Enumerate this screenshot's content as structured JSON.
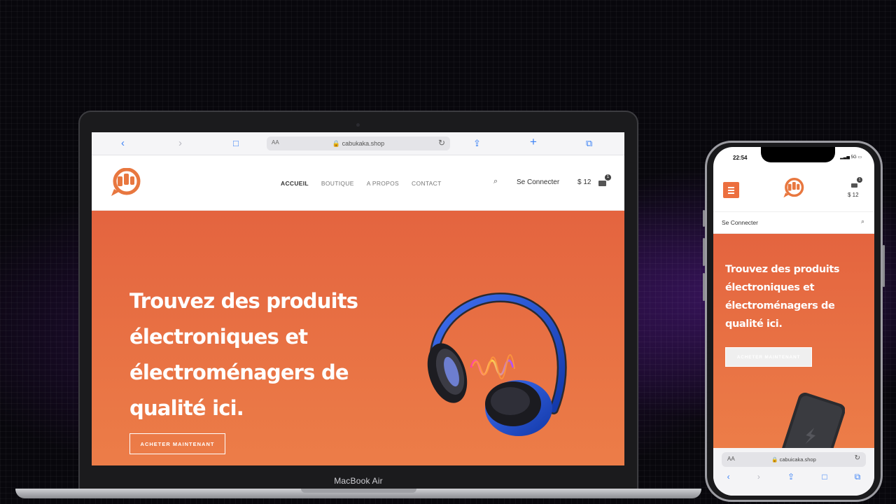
{
  "laptop": {
    "device_label": "MacBook Air",
    "browser": {
      "back": "‹",
      "forward": "›",
      "bookmarks": "□",
      "text_size": "AA",
      "address": "🔒 cabukaka.shop",
      "reload": "↻",
      "share": "⇪",
      "new_tab": "+",
      "tabs": "⧉"
    },
    "site": {
      "nav": [
        "ACCUEIL",
        "BOUTIQUE",
        "A PROPOS",
        "CONTACT"
      ],
      "search": "⌕",
      "login": "Se Connecter",
      "price": "$ 12",
      "cart_count": "1"
    },
    "hero": {
      "title": "Trouvez des produits électroniques et électroménagers de qualité ici.",
      "button": "ACHETER MAINTENANT"
    }
  },
  "phone": {
    "status": {
      "time": "22:54",
      "signal": "▂▃▅ 5G ▭"
    },
    "site": {
      "price": "$ 12",
      "cart_count": "1",
      "login": "Se Connecter",
      "search": "⌕"
    },
    "hero": {
      "title": "Trouvez des produits électroniques et électroménagers de qualité ici.",
      "button": "ACHETER MAINTENANT"
    },
    "browser": {
      "text_size": "AA",
      "address": "🔒 cabuicaka.shop",
      "reload": "↻",
      "back": "‹",
      "forward": "›",
      "share": "⇪",
      "bookmarks": "□",
      "tabs": "⧉"
    }
  },
  "colors": {
    "brand_orange": "#ec6f3f",
    "hero_top": "#e4643f",
    "hero_bottom": "#ec7d48",
    "headphone_blue": "#1f4fd1"
  }
}
